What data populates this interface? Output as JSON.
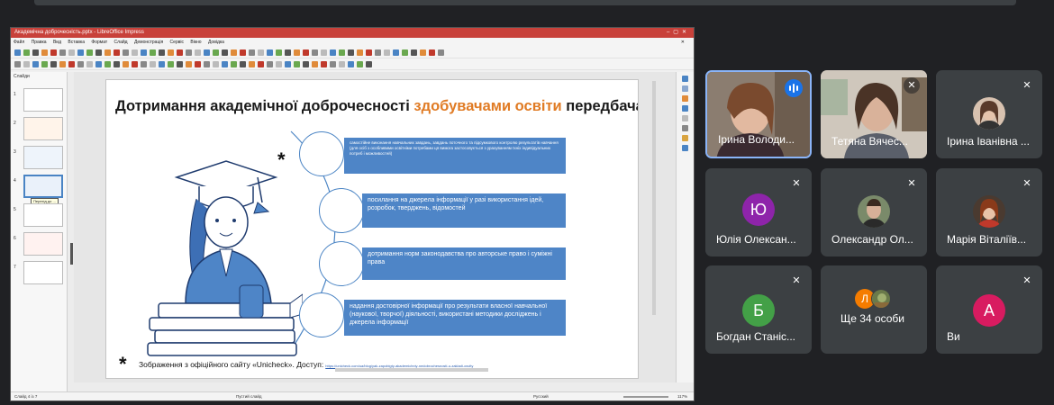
{
  "meet": {
    "participants": [
      {
        "name": "Ірина Володи...",
        "type": "video",
        "speaking": true
      },
      {
        "name": "Тетяна Вячес...",
        "type": "video",
        "muted": true
      },
      {
        "name": "Ірина Іванівна ...",
        "type": "photo",
        "muted": true
      },
      {
        "name": "Юлія Олексан...",
        "type": "initial",
        "initial": "Ю",
        "color": "#8e24aa",
        "muted": true
      },
      {
        "name": "Олександр Ол...",
        "type": "photo",
        "muted": true
      },
      {
        "name": "Марія Віталіїв...",
        "type": "photo",
        "muted": true
      },
      {
        "name": "Богдан Станіс...",
        "type": "initial",
        "initial": "Б",
        "color": "#43a047",
        "muted": true
      },
      {
        "name": "Ще 34 особи",
        "type": "more",
        "initial": "Л",
        "color": "#f57c00"
      },
      {
        "name": "Ви",
        "type": "initial",
        "initial": "А",
        "color": "#d81b60",
        "muted": true
      }
    ],
    "icons": {
      "mic_off": "mic-off-icon",
      "speaking": "speaking-indicator-icon"
    }
  },
  "impress": {
    "window_title": "Академічна доброчесність.pptx - LibreOffice Impress",
    "menu": [
      "Файл",
      "Правка",
      "Вид",
      "Вставка",
      "Формат",
      "Слайд",
      "Демонстрація",
      "Сервіс",
      "Вікно",
      "Довідка"
    ],
    "slides_pane_label": "Слайди",
    "thumb_tooltip": "Перехід до ...",
    "status": {
      "slide": "Слайд 4 із 7",
      "layout": "Пустий слайд",
      "language": "Русский",
      "zoom": "117%"
    }
  },
  "slide": {
    "title_part1": "Дотримання академічної доброчесності ",
    "title_highlight": "здобувачами освіти",
    "title_part2": " передбачає:",
    "items": [
      "самостійне виконання навчальних завдань, завдань поточного та підсумкового контролю результатів навчання (для осіб з особливими освітніми потребами ця вимога застосовується з урахуванням їхніх індивідуальних потреб і можливостей)",
      "посилання на джерела інформації у разі використання ідей, розробок, тверджень, відомостей",
      "дотримання норм законодавства про авторське право і суміжні права",
      "надання достовірної інформації про результати власної навчальної (наукової, творчої) діяльності, використані методики досліджень і джерела інформації"
    ],
    "caption": "Зображення з офіційного сайту «Unicheck». Доступ:",
    "link": "https://unicheck.com/ua/blog/yak-zapobigty-akademichniy-nedobrochesnosti-u-zakladi-osvity",
    "star": "*"
  },
  "colors": {
    "box": "#4e85c7",
    "accent": "#e07b24",
    "meet_bg": "#202124",
    "tile": "#3c4043"
  }
}
